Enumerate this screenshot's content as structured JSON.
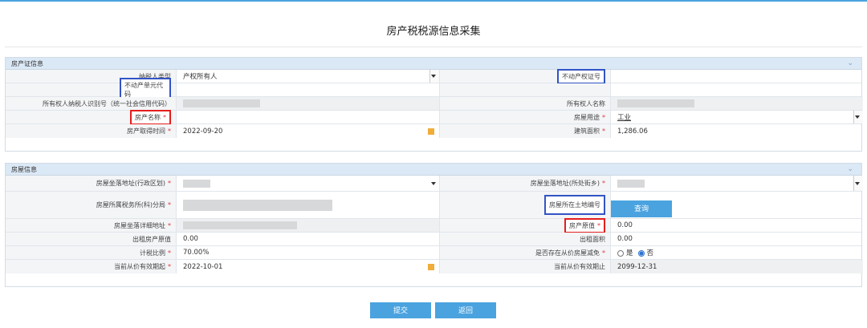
{
  "page": {
    "title": "房产税税源信息采集"
  },
  "colors": {
    "accent": "#4aa3df",
    "section_header": "#dbe8f6",
    "required": "#e0363b",
    "highlight_blue": "#3254c4",
    "highlight_red": "#e41e1e"
  },
  "cert": {
    "title": "房产证信息",
    "taxpayer_type_label": "纳税人类型",
    "taxpayer_type_value": "产权所有人",
    "property_cert_no_label": "不动产权证号",
    "property_unit_code_label": "不动产单元代码",
    "owner_taxid_label": "所有权人纳税人识别号（统一社会信用代码）",
    "owner_name_label": "所有权人名称",
    "property_name_label": "房产名称",
    "house_use_label": "房屋用途",
    "house_use_value": "工业",
    "acquire_date_label": "房产取得时间",
    "acquire_date_value": "2022-09-20",
    "building_area_label": "建筑面积",
    "building_area_value": "1,286.06",
    "required_mark": "*"
  },
  "house": {
    "title": "房屋信息",
    "addr_district_label": "房屋坐落地址(行政区划)",
    "addr_street_label": "房屋坐落地址(所处街乡)",
    "tax_office_label": "房屋所属税务所(科)分局",
    "land_no_label": "房屋所在土地编号",
    "query_button": "查询",
    "addr_detail_label": "房屋坐落详细地址",
    "original_value_label": "房产原值",
    "original_value": "0.00",
    "rent_original_label": "出租房产原值",
    "rent_original_value": "0.00",
    "rent_area_label": "出租面积",
    "rent_area_value": "0.00",
    "tax_ratio_label": "计税比例",
    "tax_ratio_value": "70.00%",
    "reduction_label": "是否存在从价房屋减免",
    "reduction_yes": "是",
    "reduction_no": "否",
    "valid_from_label": "当前从价有效期起",
    "valid_from_value": "2022-10-01",
    "valid_to_label": "当前从价有效期止",
    "valid_to_value": "2099-12-31",
    "required_mark": "*"
  },
  "actions": {
    "submit": "提交",
    "back": "返回"
  },
  "icons": {
    "collapse": "chevron-down-icon",
    "calendar": "calendar-icon",
    "dropdown": "caret-down-icon"
  }
}
